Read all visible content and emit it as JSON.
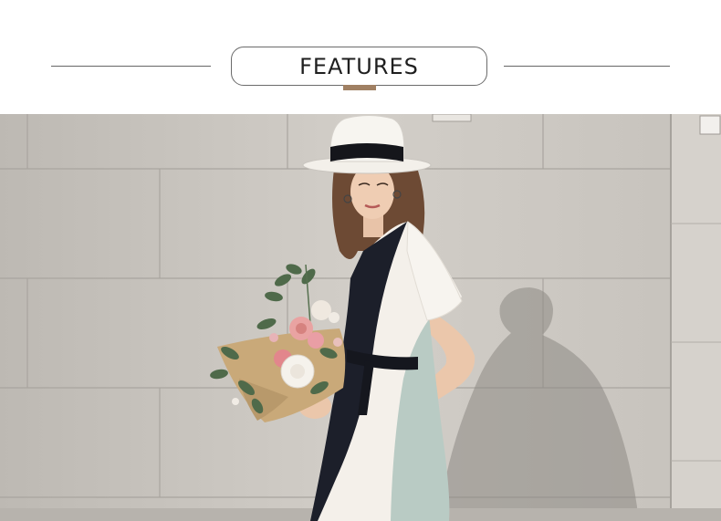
{
  "section_title": "FEATURES",
  "colors": {
    "accent": "#a08063",
    "wall": "#c9c5bf",
    "dress_black": "#1c1f2a",
    "dress_white": "#f4f0ea",
    "dress_mint": "#b9cbc4"
  },
  "photo": {
    "subject": "model-in-white-hat-with-flower-bouquet"
  }
}
